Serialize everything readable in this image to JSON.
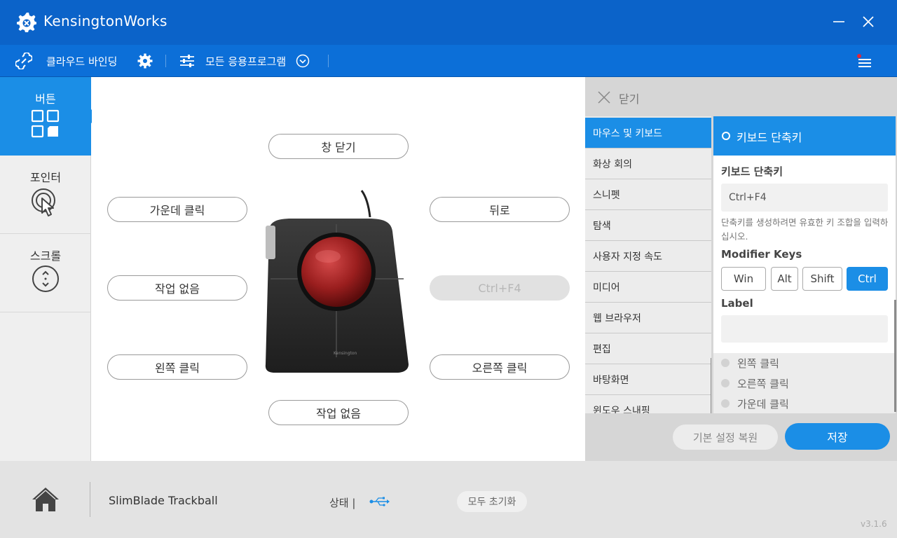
{
  "app": {
    "title": "KensingtonWorks"
  },
  "toolbar": {
    "cloud_binding": "클라우드 바인딩",
    "all_apps": "모든 응용프로그램"
  },
  "sidebar": {
    "items": [
      {
        "label": "버튼",
        "icon": "grid-icon"
      },
      {
        "label": "포인터",
        "icon": "cursor-click-icon"
      },
      {
        "label": "스크롤",
        "icon": "scroll-updown-icon"
      }
    ]
  },
  "buttons": {
    "top": "창 닫기",
    "middle_left": "가운데 클릭",
    "back": "뒤로",
    "left_mid": "작업 없음",
    "right_mid": "Ctrl+F4",
    "left_bottom": "왼쪽 클릭",
    "right_bottom": "오른쪽 클릭",
    "bottom": "작업 없음"
  },
  "panel": {
    "close": "닫기",
    "categories": [
      "마우스 및 키보드",
      "화상 회의",
      "스니펫",
      "탐색",
      "사용자 지정 속도",
      "미디어",
      "웹 브라우저",
      "편집",
      "바탕화면",
      "윈도우 스내핑"
    ],
    "detail": {
      "header": "키보드 단축키",
      "section": "키보드 단축키",
      "shortcut_value": "Ctrl+F4",
      "hint": "단축키를 생성하려면 유효한 키 조합을 입력하십시오.",
      "modifier_title": "Modifier Keys",
      "modifiers": [
        "Win",
        "Alt",
        "Shift",
        "Ctrl"
      ],
      "active_modifier": "Ctrl",
      "label_title": "Label",
      "options": [
        "왼쪽 클릭",
        "오른쪽 클릭",
        "가운데 클릭"
      ]
    },
    "restore": "기본 설정 복원",
    "save": "저장"
  },
  "footer": {
    "device": "SlimBlade Trackball",
    "status": "상태 |",
    "reset_all": "모두 초기화",
    "version": "v3.1.6"
  },
  "colors": {
    "titlebar": "#0b63c9",
    "toolbar": "#0c6fd8",
    "accent": "#1b8ee6"
  }
}
